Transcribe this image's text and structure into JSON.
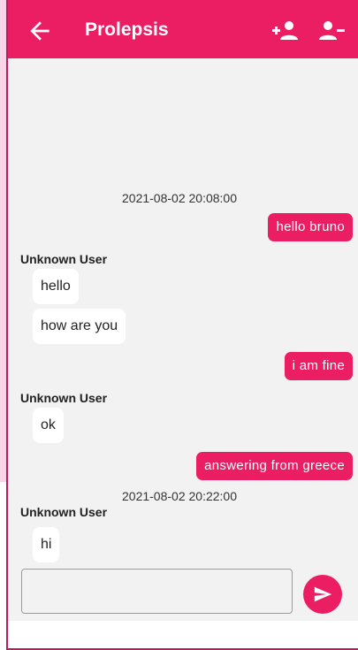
{
  "appbar": {
    "title": "Prolepsis",
    "back_icon": "arrow-back-icon",
    "add_icon": "person-add-icon",
    "remove_icon": "person-remove-icon",
    "color": "#ec1e63"
  },
  "chat": {
    "timestamps": [
      "2021-08-02 20:08:00",
      "2021-08-02 20:22:00"
    ],
    "sender_name": "Unknown User",
    "messages": {
      "m1": "hello bruno",
      "m2": "hello",
      "m3": "how are you",
      "m4": "i am fine",
      "m5": "ok",
      "m6": "answering from greece",
      "m7": "hi"
    }
  },
  "composer": {
    "input_value": "",
    "send_icon": "send-icon"
  }
}
